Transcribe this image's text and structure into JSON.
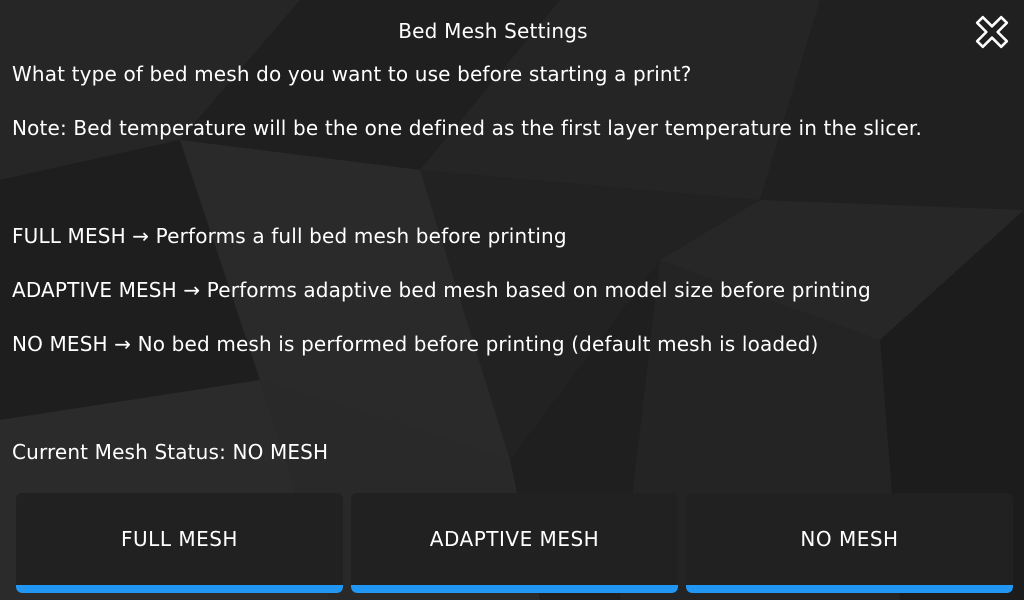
{
  "header": {
    "title": "Bed Mesh Settings",
    "close_icon": "close-icon"
  },
  "content": {
    "question": "What type of bed mesh do you want to use before starting a print?",
    "note": "Note: Bed temperature will be the one defined as the first layer temperature in the slicer.",
    "options": [
      {
        "text": "FULL MESH → Performs a full bed mesh before printing"
      },
      {
        "text": "ADAPTIVE MESH → Performs adaptive bed mesh based on model size before printing"
      },
      {
        "text": "NO MESH → No bed mesh is performed before printing (default mesh is loaded)"
      }
    ],
    "status": "Current Mesh Status: NO MESH"
  },
  "buttons": [
    {
      "label": "FULL MESH"
    },
    {
      "label": "ADAPTIVE MESH"
    },
    {
      "label": "NO MESH"
    }
  ],
  "colors": {
    "background": "#232323",
    "button_bg": "#212121",
    "accent": "#2196f3",
    "text": "#ffffff"
  }
}
